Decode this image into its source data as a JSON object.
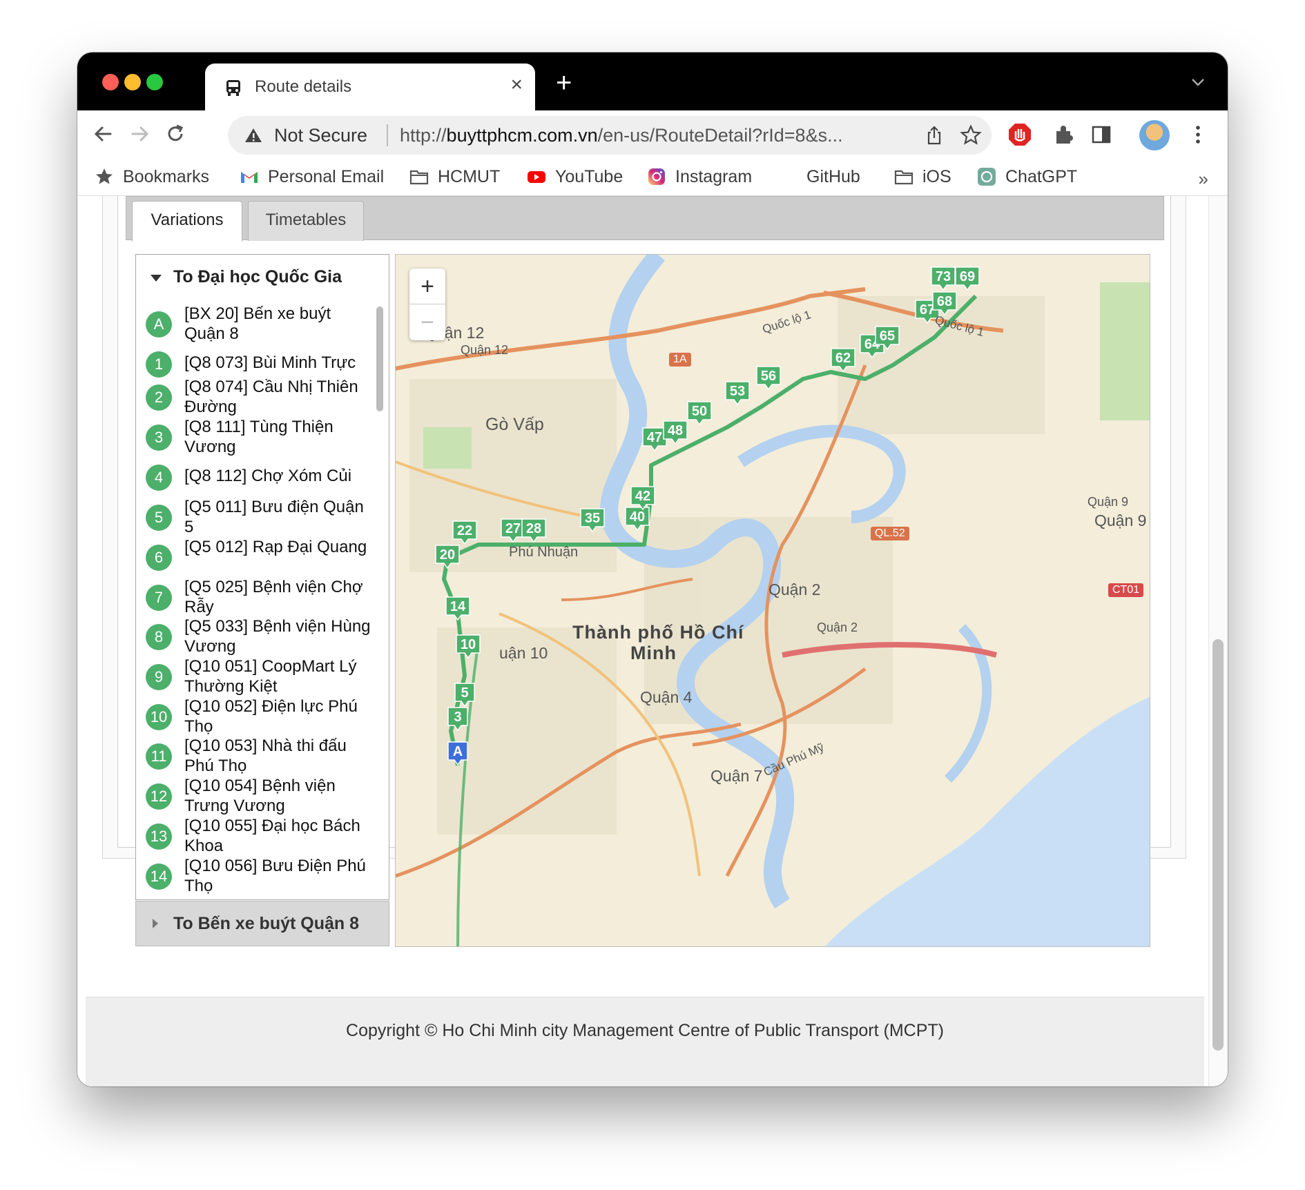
{
  "browser": {
    "tab_title": "Route details",
    "tab_close": "×",
    "new_tab": "+",
    "security_label": "Not Secure",
    "url_prefix": "http://",
    "url_domain": "buyttphcm.com.vn",
    "url_rest": "/en-us/RouteDetail?rId=8&s...",
    "colors": {
      "close": "#ff5f57",
      "minimize": "#febc2e",
      "zoom": "#28c840"
    }
  },
  "bookmarks": {
    "items": [
      {
        "label": "Bookmarks",
        "icon": "star-icon"
      },
      {
        "label": "Personal Email",
        "icon": "gmail-icon"
      },
      {
        "label": "HCMUT",
        "icon": "folder-icon"
      },
      {
        "label": "YouTube",
        "icon": "youtube-icon"
      },
      {
        "label": "Instagram",
        "icon": "instagram-icon"
      },
      {
        "label": "GitHub",
        "icon": "github-icon"
      },
      {
        "label": "iOS",
        "icon": "folder-icon"
      },
      {
        "label": "ChatGPT",
        "icon": "chatgpt-icon"
      }
    ],
    "more": "»"
  },
  "tabs": {
    "variations": "Variations",
    "timetables": "Timetables"
  },
  "variation": {
    "title": "To Đại học Quốc Gia",
    "other_title": "To Bến xe buýt Quận 8",
    "stops": [
      {
        "num": "A",
        "name": "[BX 20] Bến xe buýt Quận 8"
      },
      {
        "num": "1",
        "name": "[Q8 073] Bùi Minh Trực"
      },
      {
        "num": "2",
        "name": "[Q8 074] Cầu Nhị Thiên Đường"
      },
      {
        "num": "3",
        "name": "[Q8 111] Tùng Thiện Vương"
      },
      {
        "num": "4",
        "name": "[Q8 112] Chợ Xóm Củi"
      },
      {
        "num": "5",
        "name": "[Q5 011] Bưu điện Quận 5"
      },
      {
        "num": "6",
        "name": "[Q5 012] Rạp Đại Quang"
      },
      {
        "num": "7",
        "name": "[Q5 025] Bệnh viện Chợ Rẫy"
      },
      {
        "num": "8",
        "name": "[Q5 033] Bệnh viện Hùng Vương"
      },
      {
        "num": "9",
        "name": "[Q10 051] CoopMart Lý Thường Kiệt"
      },
      {
        "num": "10",
        "name": "[Q10 052] Điện lực Phú Thọ"
      },
      {
        "num": "11",
        "name": "[Q10 053] Nhà thi đấu Phú Thọ"
      },
      {
        "num": "12",
        "name": "[Q10 054] Bệnh viện Trưng Vương"
      },
      {
        "num": "13",
        "name": "[Q10 055] Đại học Bách Khoa"
      },
      {
        "num": "14",
        "name": "[Q10 056] Bưu Điện Phú Thọ"
      }
    ]
  },
  "map": {
    "zoom_in": "+",
    "zoom_out": "−",
    "labels": {
      "q12a": "Quận 12",
      "q12b": "Quận 12",
      "govap": "Gò Vấp",
      "city1": "Thành phố Hồ Chí",
      "city2": "Minh",
      "q2a": "Quận 2",
      "q2b": "Quận 2",
      "q4": "Quận 4",
      "q7": "Quận 7",
      "q9a": "Quận 9",
      "q9b": "Quận 9",
      "q10": "uận 10",
      "phunhuan": "Phú Nhuận",
      "ql1a": "Quốc lộ 1",
      "ql1b": "Quốc lộ 1",
      "r1a": "1A",
      "ql52": "QL.52",
      "ct01": "CT01",
      "cauphumy": "Cầu Phú Mỹ"
    },
    "markers": [
      {
        "label": "A",
        "kind": "start"
      },
      {
        "label": "3"
      },
      {
        "label": "5"
      },
      {
        "label": "10"
      },
      {
        "label": "14"
      },
      {
        "label": "20"
      },
      {
        "label": "22"
      },
      {
        "label": "27"
      },
      {
        "label": "28"
      },
      {
        "label": "35"
      },
      {
        "label": "40"
      },
      {
        "label": "42"
      },
      {
        "label": "47"
      },
      {
        "label": "48"
      },
      {
        "label": "50"
      },
      {
        "label": "53"
      },
      {
        "label": "56"
      },
      {
        "label": "62"
      },
      {
        "label": "64"
      },
      {
        "label": "65"
      },
      {
        "label": "67"
      },
      {
        "label": "68"
      },
      {
        "label": "73"
      },
      {
        "label": "69"
      }
    ],
    "route_color": "#4caf6a"
  },
  "footer": {
    "copyright": "Copyright © Ho Chi Minh city Management Centre of Public Transport (MCPT)"
  }
}
